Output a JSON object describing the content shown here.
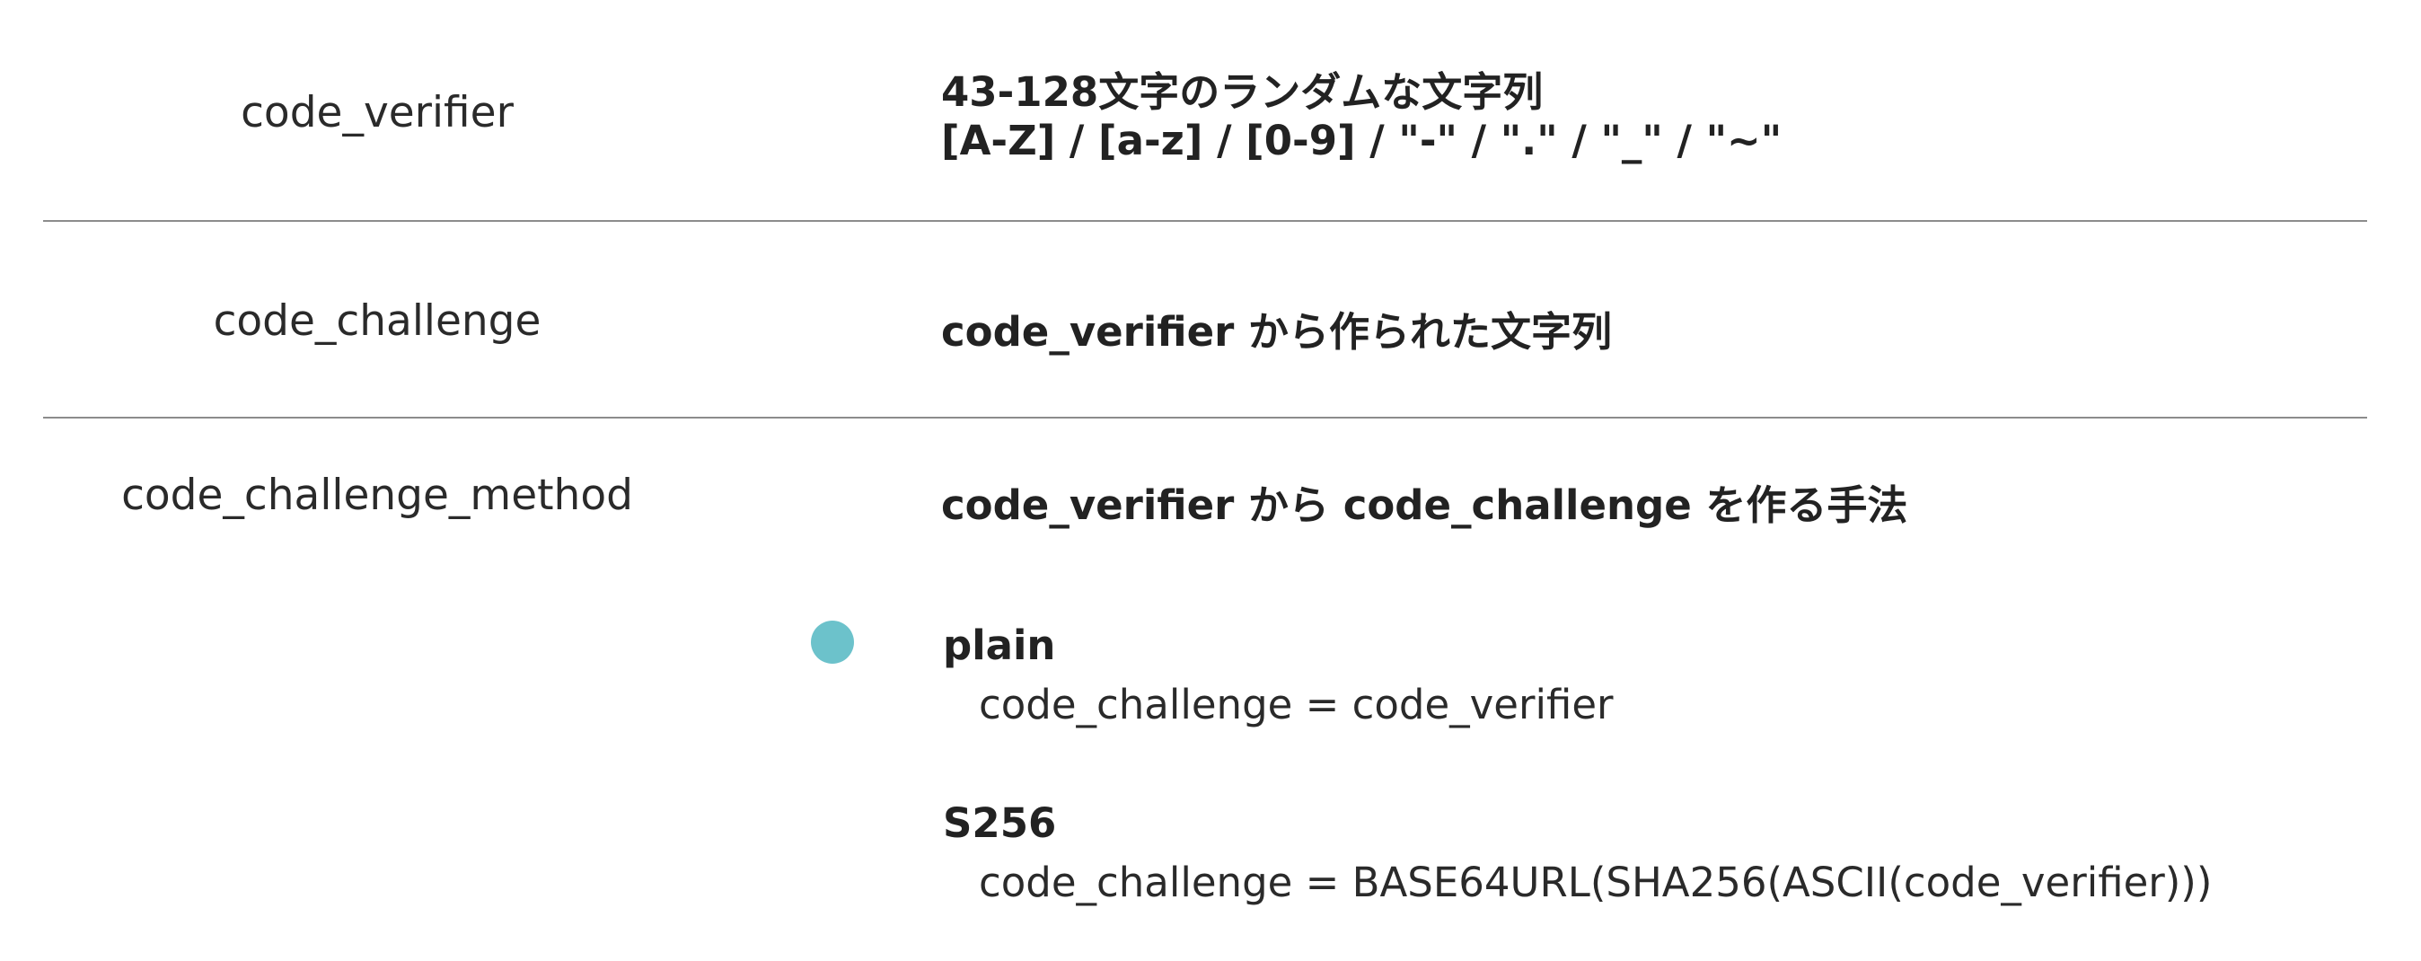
{
  "rows": [
    {
      "term": "code_verifier",
      "description_lines": [
        "43-128文字のランダムな文字列",
        "[A-Z] / [a-z] / [0-9] / \"-\" / \".\" / \"_\" / \"~\""
      ]
    },
    {
      "term": "code_challenge",
      "description_lines": [
        "code_verifier から作られた文字列"
      ]
    },
    {
      "term": "code_challenge_method",
      "description_lines": [
        "code_verifier から code_challenge を作る手法"
      ],
      "methods": [
        {
          "name": "plain",
          "formula": "code_challenge = code_verifier"
        },
        {
          "name": "S256",
          "formula": "code_challenge = BASE64URL(SHA256(ASCII(code_verifier)))"
        }
      ]
    }
  ],
  "colors": {
    "bullet": "#6cc2cb",
    "divider": "#8c8c8c",
    "text": "#222222"
  }
}
